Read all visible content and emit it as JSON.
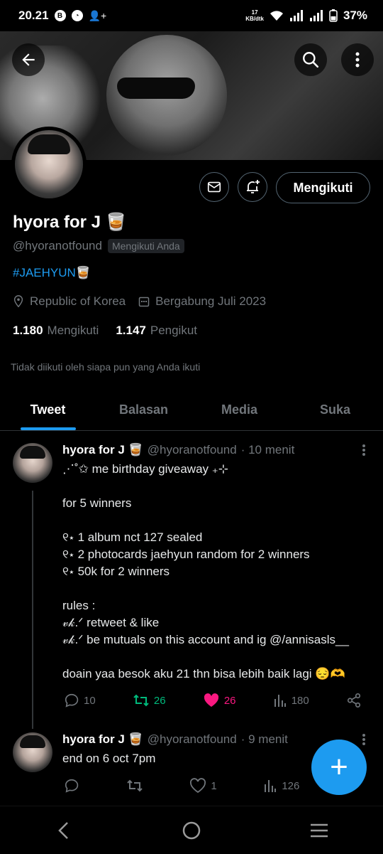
{
  "status_bar": {
    "time": "20.21",
    "net_speed_value": "17",
    "net_speed_unit": "KB/dtk",
    "battery": "37%"
  },
  "profile": {
    "follow_button": "Mengikuti",
    "name": "hyora for J 🥃",
    "handle": "@hyoranotfound",
    "follows_you": "Mengikuti Anda",
    "bio": "#JAEHYUN🥃",
    "location": "Republic of Korea",
    "joined": "Bergabung Juli 2023",
    "following_count": "1.180",
    "following_label": "Mengikuti",
    "followers_count": "1.147",
    "followers_label": "Pengikut",
    "not_followed_note": "Tidak diikuti oleh siapa pun yang Anda ikuti"
  },
  "tabs": [
    {
      "label": "Tweet",
      "active": true
    },
    {
      "label": "Balasan",
      "active": false
    },
    {
      "label": "Media",
      "active": false
    },
    {
      "label": "Suka",
      "active": false
    }
  ],
  "tweets": [
    {
      "name": "hyora for J 🥃",
      "handle": "@hyoranotfound",
      "time": "· 10 menit",
      "lines": [
        "⋰˚✩ me birthday giveaway ₊⊹",
        "",
        "for 5 winners",
        "",
        "୧⋆ 1 album nct 127 sealed",
        "୧⋆ 2 photocards jaehyun random for 2 winners",
        "୧⋆ 50k for 2 winners",
        "",
        "rules :",
        "𝓋𝓀.ᐟ retweet & like",
        "𝓋𝓀.ᐟ be mutuals on this account and ig @/annisasls__",
        "",
        "doain yaa besok aku 21 thn bisa lebih baik lagi 😔🫶"
      ],
      "replies": "10",
      "retweets": "26",
      "likes": "26",
      "views": "180"
    },
    {
      "name": "hyora for J 🥃",
      "handle": "@hyoranotfound",
      "time": "· 9 menit",
      "lines": [
        "end on 6 oct 7pm"
      ],
      "replies": "",
      "retweets": "",
      "likes": "1",
      "views": "126"
    }
  ],
  "fab": {
    "label": "+"
  },
  "colors": {
    "accent": "#1d9bf0",
    "retweet": "#00ba7c",
    "like": "#f91880",
    "muted": "#71767b"
  }
}
